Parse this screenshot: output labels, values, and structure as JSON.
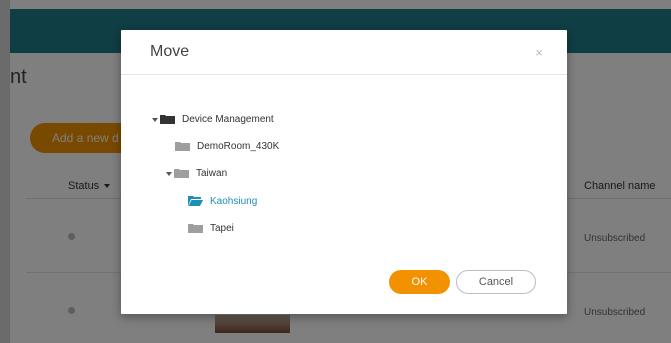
{
  "background": {
    "page_title": "nt",
    "add_button_label": "Add a new d",
    "columns": {
      "status": "Status",
      "channel": "Channel name"
    },
    "rows": [
      {
        "channel_status": "Unsubscribed"
      },
      {
        "channel_status": "Unsubscribed"
      }
    ]
  },
  "modal": {
    "title": "Move",
    "close_glyph": "×",
    "tree": [
      {
        "label": "Device Management",
        "icon": "folder-icon",
        "expanded": true
      },
      {
        "label": "DemoRoom_430K",
        "icon": "folder-icon"
      },
      {
        "label": "Taiwan",
        "icon": "folder-icon",
        "expanded": true
      },
      {
        "label": "Kaohsiung",
        "icon": "folder-open-icon",
        "selected": true
      },
      {
        "label": "Tapei",
        "icon": "folder-icon"
      }
    ],
    "ok_label": "OK",
    "cancel_label": "Cancel"
  },
  "colors": {
    "header_teal": "#1f7c8a",
    "accent_orange": "#f39200",
    "selected_blue": "#1e8fb5",
    "folder_gray": "#9e9e9e",
    "folder_dark": "#333333"
  }
}
